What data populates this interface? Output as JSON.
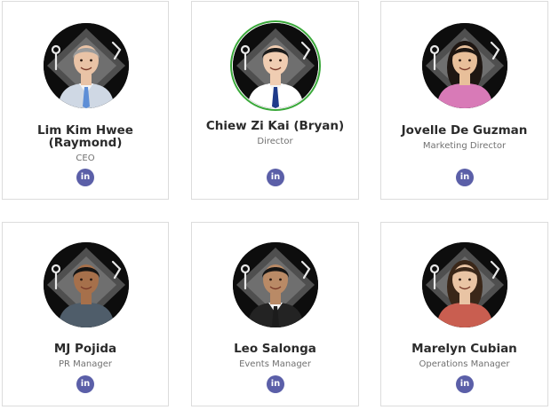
{
  "team": [
    {
      "name": "Lim Kim Hwee (Raymond)",
      "role": "CEO",
      "linkedin_icon": "linkedin-icon",
      "skin": "#e9c3a6",
      "hair": "#9b9b9b",
      "shirt": "#cfd8e4",
      "tie": "#5d8ed6"
    },
    {
      "name": "Chiew Zi Kai (Bryan)",
      "role": "Director",
      "linkedin_icon": "linkedin-icon",
      "skin": "#f0cdb2",
      "hair": "#1b1b1b",
      "shirt": "#ffffff",
      "tie": "#1e3a8a"
    },
    {
      "name": "Jovelle De Guzman",
      "role": "Marketing Director",
      "linkedin_icon": "linkedin-icon",
      "skin": "#e8bf9a",
      "hair": "#1e1612",
      "shirt": "#d87ab7",
      "tie": ""
    },
    {
      "name": "MJ Pojida",
      "role": "PR Manager",
      "linkedin_icon": "linkedin-icon",
      "skin": "#a6704b",
      "hair": "#141414",
      "shirt": "#4f5d6a",
      "tie": ""
    },
    {
      "name": "Leo Salonga",
      "role": "Events Manager",
      "linkedin_icon": "linkedin-icon",
      "skin": "#b98a66",
      "hair": "#141414",
      "shirt": "#232323",
      "tie": "#1c1c1c"
    },
    {
      "name": "Marelyn Cubian",
      "role": "Operations Manager",
      "linkedin_icon": "linkedin-icon",
      "skin": "#e9c4a4",
      "hair": "#3a2719",
      "shirt": "#c95e50",
      "tie": ""
    }
  ],
  "linkedin_label": "in",
  "colors": {
    "card_border": "#dcdcdc",
    "name": "#2b2b2b",
    "role": "#707070",
    "linkedin_bg": "#5b5fa8",
    "highlight_ring": "#3aa83a"
  }
}
